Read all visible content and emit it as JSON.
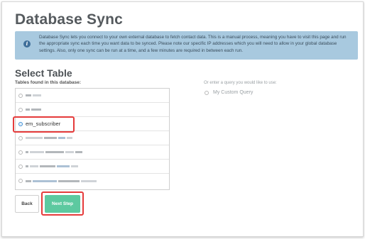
{
  "page": {
    "title": "Database Sync",
    "info_text": "Database Sync lets you connect to your own external database to fetch contact data. This is a manual process, meaning you have to visit this page and run the appropriate sync each time you want data to be synced. Please note our specific IP addresses which you will need to allow in your global database settings. Also, only one sync can be run at a time, and a few minutes are required in between each run."
  },
  "select_table": {
    "heading": "Select Table",
    "tables_label": "Tables found in this database:",
    "tables": [
      {
        "label": "",
        "selected": false,
        "obscured": true
      },
      {
        "label": "",
        "selected": false,
        "obscured": true
      },
      {
        "label": "em_subscriber",
        "selected": true,
        "obscured": false
      },
      {
        "label": "",
        "selected": false,
        "obscured": true
      },
      {
        "label": "",
        "selected": false,
        "obscured": true
      },
      {
        "label": "",
        "selected": false,
        "obscured": true
      },
      {
        "label": "",
        "selected": false,
        "obscured": true
      }
    ]
  },
  "query": {
    "label": "Or enter a query you would like to use:",
    "custom_option": "My Custom Query"
  },
  "buttons": {
    "back": "Back",
    "next": "Next Step"
  },
  "colors": {
    "info_bg": "#a8c9df",
    "accent_green": "#5dc9a0",
    "highlight_red": "#e53b3b",
    "radio_selected": "#3d8fd6"
  }
}
